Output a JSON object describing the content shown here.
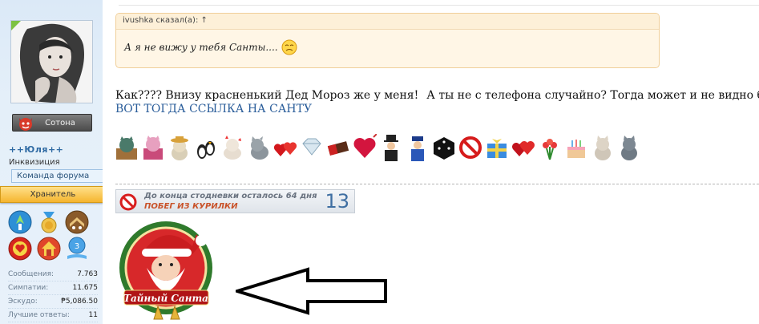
{
  "user": {
    "avatar_icon": "avatar-image",
    "title_label": "Сотона",
    "name": "++Юля++",
    "rank": "Инквизиция",
    "team_label": "Команда форума",
    "keeper_label": "Хранитель",
    "awards": [
      "ufo-award-icon",
      "medal-award-icon",
      "chevron-stars-award-icon",
      "heart-award-icon",
      "house-award-icon",
      "book-level-3-award-icon"
    ],
    "award_level_text": "3",
    "stats": [
      {
        "label": "Сообщения:",
        "value": "7.763"
      },
      {
        "label": "Симпатии:",
        "value": "11.675"
      },
      {
        "label": "Эскудо:",
        "value": "₱5,086.50"
      },
      {
        "label": "Лучшие ответы:",
        "value": "11"
      }
    ]
  },
  "post": {
    "quote_header": "ivushka сказал(а): ↑",
    "quote_text": "А я не вижу у тебя Санты....",
    "message_part1": "Как???? Внизу красненький Дед Мороз же у меня!",
    "message_part2": "А ты не с телефона случайно? Тогда может и не видно быть...",
    "link_text": "ВОТ ТОГДА ССЫЛКА НА САНТУ",
    "smileys": [
      "cat-box-icon",
      "pink-cat-icon",
      "cat-hat-icon",
      "penguins-icon",
      "cat-hearts-icon",
      "grey-cat-icon",
      "hearts-icon",
      "diamond-icon",
      "chocolate-icon",
      "heart-balloon-icon",
      "top-hat-man-icon",
      "policeman-icon",
      "dice-icon",
      "no-sign-icon",
      "gift-icon",
      "red-hearts-icon",
      "flowers-icon",
      "cake-icon",
      "cat-sitting-icon",
      "cat-grey-icon"
    ]
  },
  "signature": {
    "banner_line1": "До конца стодневки осталось 64 дня",
    "banner_line2": "ПОБЕГ ИЗ КУРИЛКИ",
    "banner_number": "13",
    "santa_caption": "Тайный Санта",
    "arrow": "left-arrow-icon"
  },
  "colors": {
    "sidebar_bg": "#e4eff9",
    "link": "#2a5d9a",
    "quote_bg": "#fff6e6",
    "keeper_gold": "#f5b52f"
  }
}
